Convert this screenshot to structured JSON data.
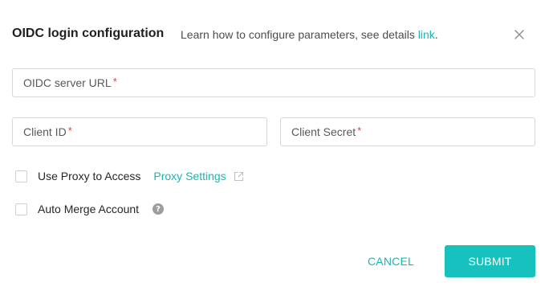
{
  "dialog": {
    "title": "OIDC login configuration",
    "subtitle": "Learn how to configure parameters, see details ",
    "subtitle_link": "link",
    "subtitle_end": "."
  },
  "fields": {
    "server_url": {
      "placeholder": "OIDC server URL",
      "required_mark": "*"
    },
    "client_id": {
      "placeholder": "Client ID",
      "required_mark": "*"
    },
    "client_secret": {
      "placeholder": "Client Secret",
      "required_mark": "*"
    }
  },
  "options": {
    "use_proxy": {
      "label": "Use Proxy to Access",
      "checked": false,
      "link": "Proxy Settings",
      "link_icon": "external-link-icon"
    },
    "auto_merge": {
      "label": "Auto Merge Account",
      "checked": false,
      "help_icon": "help-icon",
      "help_glyph": "?"
    }
  },
  "actions": {
    "cancel": "CANCEL",
    "submit": "SUBMIT"
  },
  "colors": {
    "accent": "#17c2be",
    "link": "#17b7b4",
    "required": "#e5403a",
    "border": "#d9d9d9"
  }
}
